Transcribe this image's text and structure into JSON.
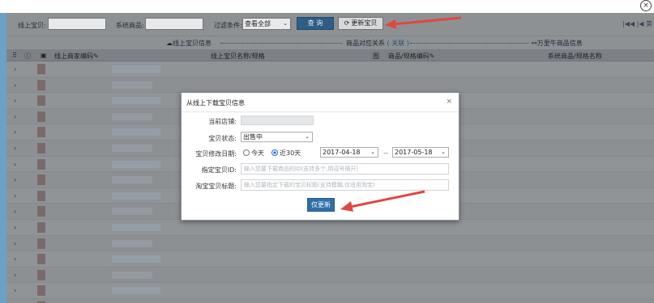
{
  "window": {
    "corner_close": "×"
  },
  "toolbar": {
    "online_item_label": "线上宝贝:",
    "system_item_label": "系统商品:",
    "filter_label": "过滤条件:",
    "filter_value": "查看全部",
    "query_button": "查 询",
    "update_button": "更新宝贝",
    "update_icon": "refresh-icon",
    "pager": "|◀◀  |◀  第"
  },
  "groups": {
    "online_info": "线上宝贝信息",
    "relation": "商品对应关系",
    "relation_link": "( 关联 )",
    "wanli_info": "万里牛商品信息"
  },
  "columns": {
    "online_code": "线上商家编码",
    "online_name": "线上宝贝名称/规格",
    "image": "图",
    "product_code": "商品/规格编码",
    "system_name": "系统商品/规格名称"
  },
  "rows": [
    {
      "expand": "›"
    },
    {
      "expand": "›"
    },
    {
      "expand": "›"
    },
    {
      "expand": "›"
    },
    {
      "expand": "›"
    },
    {
      "expand": "›"
    },
    {
      "expand": "›"
    },
    {
      "expand": "›"
    },
    {
      "expand": "›"
    },
    {
      "expand": "›"
    },
    {
      "expand": "›"
    },
    {
      "expand": "›"
    },
    {
      "expand": "›"
    },
    {
      "expand": "›"
    },
    {
      "expand": "›"
    },
    {
      "expand": "›"
    }
  ],
  "modal": {
    "title": "从线上下载宝贝信息",
    "close": "×",
    "shop_label": "当前店铺:",
    "status_label": "宝贝状态:",
    "status_value": "出售中",
    "date_label": "宝贝修改日期:",
    "today": "今天",
    "last30": "近30天",
    "date_from": "2017-04-18",
    "date_sep": "--",
    "date_to": "2017-05-18",
    "item_id_label": "指定宝贝ID:",
    "item_id_placeholder": "输入您要下载商品的ID(支持多个,用逗号隔开)",
    "title_label": "淘宝宝贝标题:",
    "title_placeholder": "输入您要指定下载的宝贝标题(支持模糊,仅适用淘宝)",
    "only_update_button": "仅更新"
  },
  "colors": {
    "primary_button": "#2e6fa8",
    "arrow": "#e0483e",
    "overlay": "#8f9396"
  }
}
